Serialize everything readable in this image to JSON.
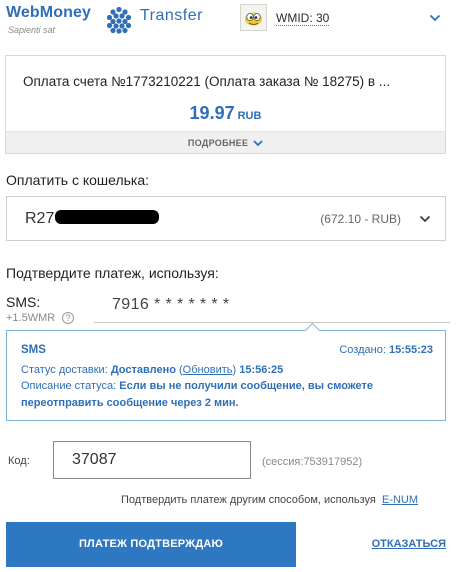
{
  "header": {
    "brand": "WebMoney",
    "slogan": "Sapienti sat",
    "product": "Transfer",
    "wmid_label": "WMID: 30",
    "brand_color": "#2f6fb8"
  },
  "invoice": {
    "description": "Оплата счета №1773210221 (Оплата заказа № 18275) в ...",
    "amount": "19.97",
    "currency": "RUB",
    "more_label": "ПОДРОБНЕЕ"
  },
  "wallet": {
    "section_label": "Оплатить с кошелька:",
    "purse_prefix": "R27",
    "balance": "(672.10 - RUB)"
  },
  "confirmation": {
    "section_label": "Подтвердите платеж, используя:",
    "method_label": "SMS:",
    "fee": "+1.5WMR",
    "help_icon": "?",
    "phone": "7916 * * * * * * *"
  },
  "sms_status": {
    "title": "SMS",
    "created_label": "Создано:",
    "created_time": "15:55:23",
    "delivery_label": "Статус доставки:",
    "delivery_value": "Доставлено",
    "refresh_label": "Обновить",
    "delivery_time": "15:56:25",
    "description_label": "Описание статуса:",
    "description_text": "Если вы не получили сообщение, вы сможете переотправить сообщение через 2 мин."
  },
  "code": {
    "label": "Код:",
    "value": "37087",
    "session": "(сессия:753917952)"
  },
  "alternative": {
    "text": "Подтвердить платеж другим способом, используя",
    "link": "E-NUM"
  },
  "actions": {
    "confirm_label": "ПЛАТЕЖ ПОДТВЕРЖДАЮ",
    "cancel_label": "ОТКАЗАТЬСЯ",
    "primary_color": "#2e78c2"
  }
}
